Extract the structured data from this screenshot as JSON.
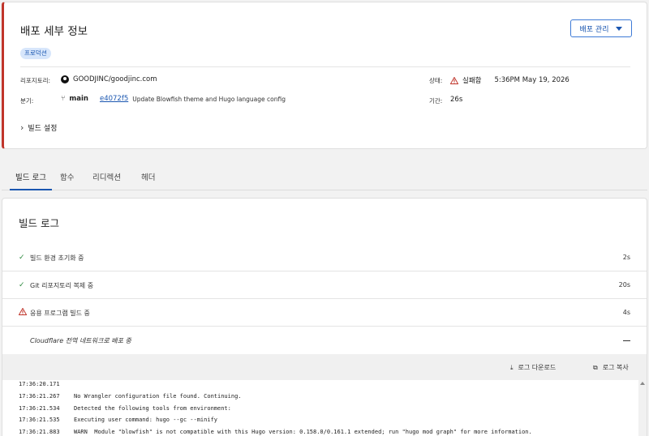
{
  "deployment": {
    "title": "배포 세부 정보",
    "badge": "프로덕션",
    "manage_label": "배포 관리",
    "repo_label": "리포지토리:",
    "repo_value": "GOODJINC/goodjinc.com",
    "branch_label": "분기:",
    "branch_value": "main",
    "commit_hash": "e4072f5",
    "commit_message": "Update Blowfish theme and Hugo language config",
    "status_label": "상태:",
    "status_value": "실패함",
    "status_time": "5:36PM May 19, 2026",
    "duration_label": "기간:",
    "duration_value": "26s",
    "build_settings": "빌드 설정",
    "accent": "#c0352b"
  },
  "tabs": [
    {
      "label": "빌드 로그"
    },
    {
      "label": "함수"
    },
    {
      "label": "리디렉션"
    },
    {
      "label": "헤더"
    }
  ],
  "build_log": {
    "title": "빌드 로그",
    "steps": [
      {
        "label": "빌드 환경 초기화 중",
        "duration": "2s",
        "status": "success"
      },
      {
        "label": "Git 리포지토리 복제 중",
        "duration": "20s",
        "status": "success"
      },
      {
        "label": "응용 프로그램 빌드 중",
        "duration": "4s",
        "status": "failed"
      },
      {
        "label": "Cloudflare 전역 네트워크로 배포 중",
        "duration": "",
        "status": "pending"
      }
    ],
    "download_label": "로그 다운로드",
    "copy_label": "로그 복사",
    "lines": [
      {
        "time": "17:36:20.171",
        "text": ""
      },
      {
        "time": "17:36:21.267",
        "text": "No Wrangler configuration file found. Continuing."
      },
      {
        "time": "17:36:21.534",
        "text": "Detected the following tools from environment:"
      },
      {
        "time": "17:36:21.535",
        "text": "Executing user command: hugo --gc --minify"
      },
      {
        "time": "17:36:21.883",
        "text": "WARN  Module \"blowfish\" is not compatible with this Hugo version: 0.158.0/0.161.1 extended; run \"hugo mod graph\" for more information."
      }
    ]
  }
}
